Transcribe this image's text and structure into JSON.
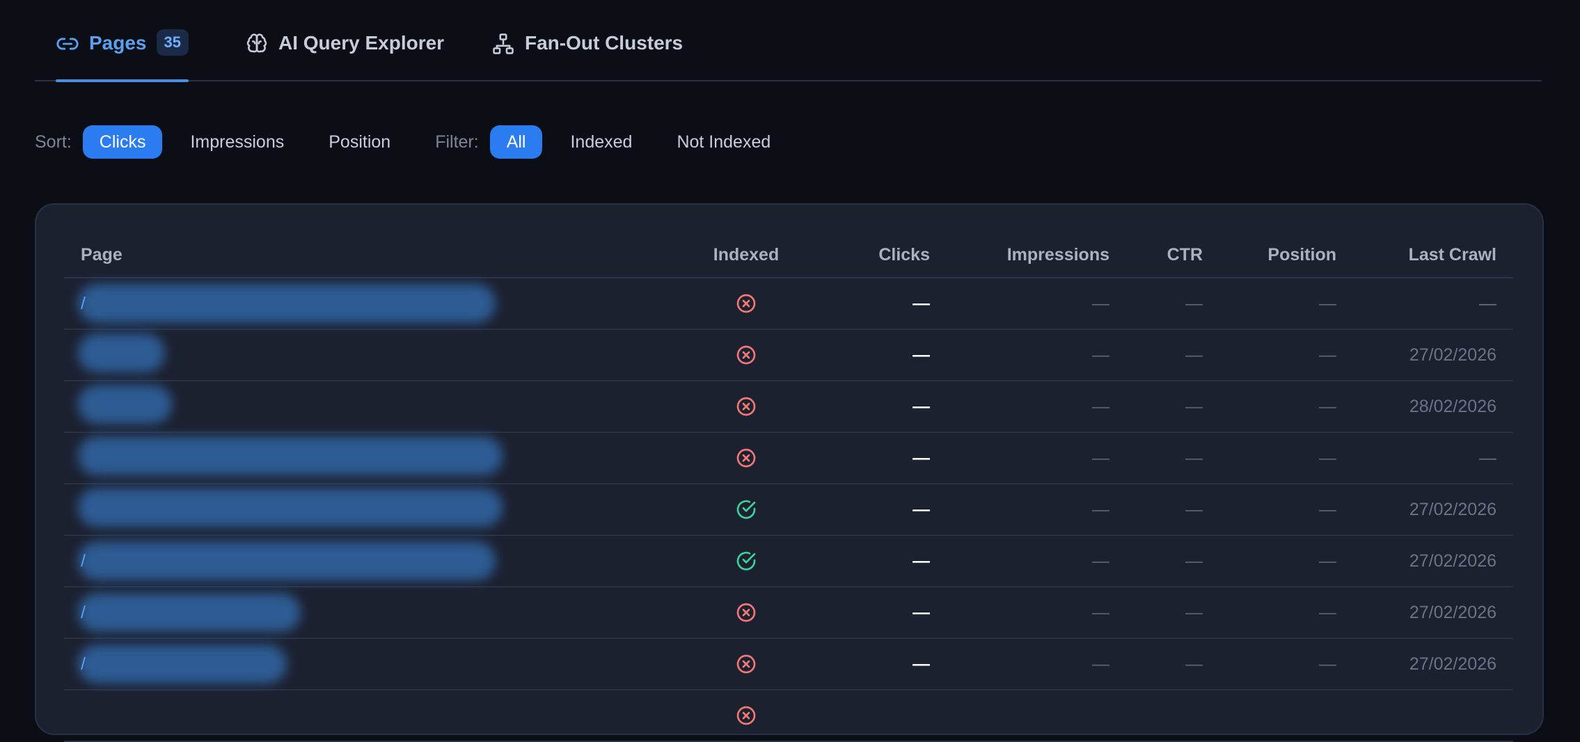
{
  "tabs": [
    {
      "label": "Pages",
      "badge": "35",
      "icon": "link-icon"
    },
    {
      "label": "AI Query Explorer",
      "icon": "brain-icon"
    },
    {
      "label": "Fan-Out Clusters",
      "icon": "sitemap-icon"
    }
  ],
  "sort": {
    "label": "Sort:",
    "options": [
      "Clicks",
      "Impressions",
      "Position"
    ],
    "selected": "Clicks"
  },
  "filter": {
    "label": "Filter:",
    "options": [
      "All",
      "Indexed",
      "Not Indexed"
    ],
    "selected": "All"
  },
  "table": {
    "columns": [
      "Page",
      "Indexed",
      "Clicks",
      "Impressions",
      "CTR",
      "Position",
      "Last Crawl"
    ],
    "rows": [
      {
        "page": "/",
        "indexed": false,
        "clicks": "—",
        "impressions": "—",
        "ctr": "—",
        "position": "—",
        "last_crawl": "—"
      },
      {
        "page": "",
        "indexed": false,
        "clicks": "—",
        "impressions": "—",
        "ctr": "—",
        "position": "—",
        "last_crawl": "27/02/2026"
      },
      {
        "page": "",
        "indexed": false,
        "clicks": "—",
        "impressions": "—",
        "ctr": "—",
        "position": "—",
        "last_crawl": "28/02/2026"
      },
      {
        "page": "",
        "indexed": false,
        "clicks": "—",
        "impressions": "—",
        "ctr": "—",
        "position": "—",
        "last_crawl": "—"
      },
      {
        "page": "",
        "indexed": true,
        "clicks": "—",
        "impressions": "—",
        "ctr": "—",
        "position": "—",
        "last_crawl": "27/02/2026"
      },
      {
        "page": "/",
        "indexed": true,
        "clicks": "—",
        "impressions": "—",
        "ctr": "—",
        "position": "—",
        "last_crawl": "27/02/2026"
      },
      {
        "page": "/",
        "indexed": false,
        "clicks": "—",
        "impressions": "—",
        "ctr": "—",
        "position": "—",
        "last_crawl": "27/02/2026"
      },
      {
        "page": "/",
        "indexed": false,
        "clicks": "—",
        "impressions": "—",
        "ctr": "—",
        "position": "—",
        "last_crawl": "27/02/2026"
      },
      {
        "page": "",
        "indexed": false,
        "clicks": "",
        "impressions": "",
        "ctr": "",
        "position": "",
        "last_crawl": ""
      }
    ]
  },
  "colors": {
    "accent": "#2a7cf0",
    "link": "#5aa0f2",
    "not_indexed": "#f07878",
    "indexed": "#3ecf9a"
  }
}
